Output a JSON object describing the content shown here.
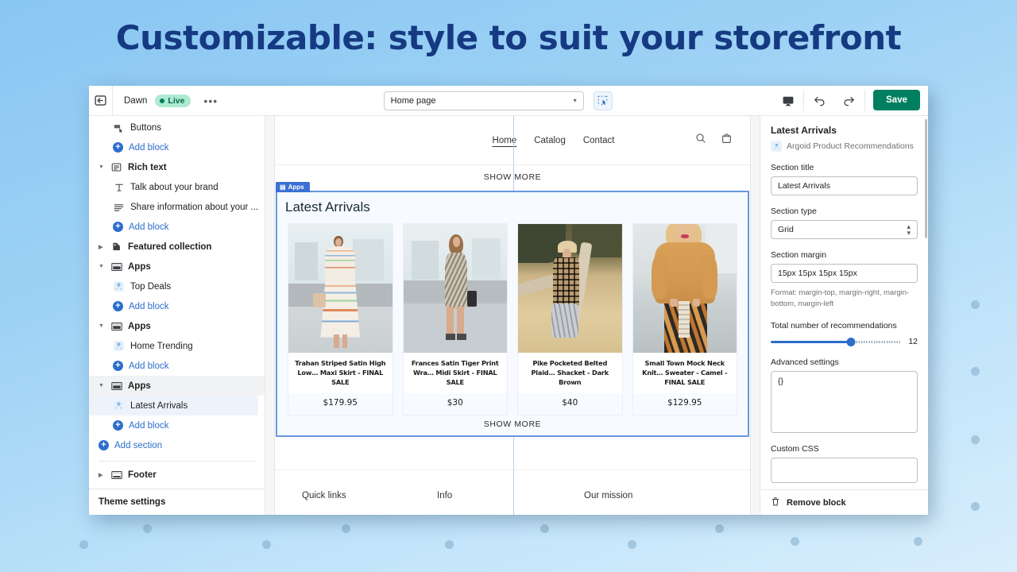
{
  "banner": {
    "title": "Customizable: style to suit your storefront"
  },
  "topbar": {
    "back_icon": "back-arrow-icon",
    "theme_name": "Dawn",
    "status_badge": "Live",
    "more_menu": "•••",
    "page_selector": {
      "value": "Home page",
      "caret": "▾"
    },
    "inspect_icon": "inspector-select-icon",
    "device_icon": "desktop-preview-icon",
    "undo_icon": "undo-icon",
    "redo_icon": "redo-icon",
    "save_label": "Save"
  },
  "sidebar": {
    "items": [
      {
        "label": "Buttons",
        "type": "block",
        "icon": "buttons-icon"
      },
      {
        "label": "Add block",
        "type": "add",
        "icon": "plus-icon"
      },
      {
        "label": "Rich text",
        "type": "section",
        "icon": "rich-text-icon",
        "expanded": true
      },
      {
        "label": "Talk about your brand",
        "type": "block",
        "icon": "text-t-icon"
      },
      {
        "label": "Share information about your ...",
        "type": "block",
        "icon": "lines-icon"
      },
      {
        "label": "Add block",
        "type": "add",
        "icon": "plus-icon"
      },
      {
        "label": "Featured collection",
        "type": "section",
        "icon": "collection-tag-icon",
        "expanded": false
      },
      {
        "label": "Apps",
        "type": "section",
        "icon": "apps-icon",
        "expanded": true
      },
      {
        "label": "Top Deals",
        "type": "block",
        "icon": "argoid-app-icon"
      },
      {
        "label": "Add block",
        "type": "add",
        "icon": "plus-icon"
      },
      {
        "label": "Apps",
        "type": "section",
        "icon": "apps-icon",
        "expanded": true
      },
      {
        "label": "Home Trending",
        "type": "block",
        "icon": "argoid-app-icon"
      },
      {
        "label": "Add block",
        "type": "add",
        "icon": "plus-icon"
      },
      {
        "label": "Apps",
        "type": "section",
        "icon": "apps-icon",
        "expanded": true,
        "selected": true
      },
      {
        "label": "Latest Arrivals",
        "type": "block",
        "icon": "argoid-app-icon",
        "selected": true
      },
      {
        "label": "Add block",
        "type": "add",
        "icon": "plus-icon"
      },
      {
        "label": "Add section",
        "type": "add",
        "icon": "plus-icon"
      },
      {
        "label": "Footer",
        "type": "section",
        "icon": "footer-icon",
        "expanded": false
      }
    ],
    "footer_label": "Theme settings"
  },
  "preview": {
    "nav": [
      {
        "label": "Home",
        "active": true
      },
      {
        "label": "Catalog",
        "active": false
      },
      {
        "label": "Contact",
        "active": false
      }
    ],
    "search_icon": "search-icon",
    "cart_icon": "shopping-bag-icon",
    "top_show_more": "SHOW MORE",
    "section": {
      "badge": "Apps",
      "title": "Latest Arrivals",
      "show_more": "SHOW MORE",
      "products": [
        {
          "name": "Trahan Striped Satin High Low… Maxi Skirt - FINAL SALE",
          "price": "$179.95"
        },
        {
          "name": "Frances Satin Tiger Print Wra… Midi Skirt - FINAL SALE",
          "price": "$30"
        },
        {
          "name": "Pike Pocketed Belted Plaid… Shacket - Dark Brown",
          "price": "$40"
        },
        {
          "name": "Small Town Mock Neck Knit… Sweater - Camel - FINAL SALE",
          "price": "$129.95"
        }
      ]
    },
    "footer_columns": [
      "Quick links",
      "Info",
      "Our mission"
    ]
  },
  "right_panel": {
    "block_title": "Latest Arrivals",
    "app_name": "Argoid Product Recommendations",
    "section_title_label": "Section title",
    "section_title_value": "Latest Arrivals",
    "section_type_label": "Section type",
    "section_type_value": "Grid",
    "section_margin_label": "Section margin",
    "section_margin_value": "15px 15px 15px 15px",
    "section_margin_hint": "Format: margin-top, margin-right, margin-bottom, margin-left",
    "recommendations_label": "Total number of recommendations",
    "recommendations_value": "12",
    "advanced_label": "Advanced settings",
    "advanced_value": "{}",
    "custom_css_label": "Custom CSS",
    "custom_css_value": "",
    "remove_label": "Remove block",
    "trash_icon": "trash-icon"
  },
  "colors": {
    "accent_blue": "#2c6ecb",
    "save_green": "#008060",
    "live_badge_bg": "#aee9d1",
    "section_outline": "#6699e0",
    "background_top": "#88c6f2",
    "background_bottom": "#d8eefc",
    "title_navy": "#163a82"
  }
}
